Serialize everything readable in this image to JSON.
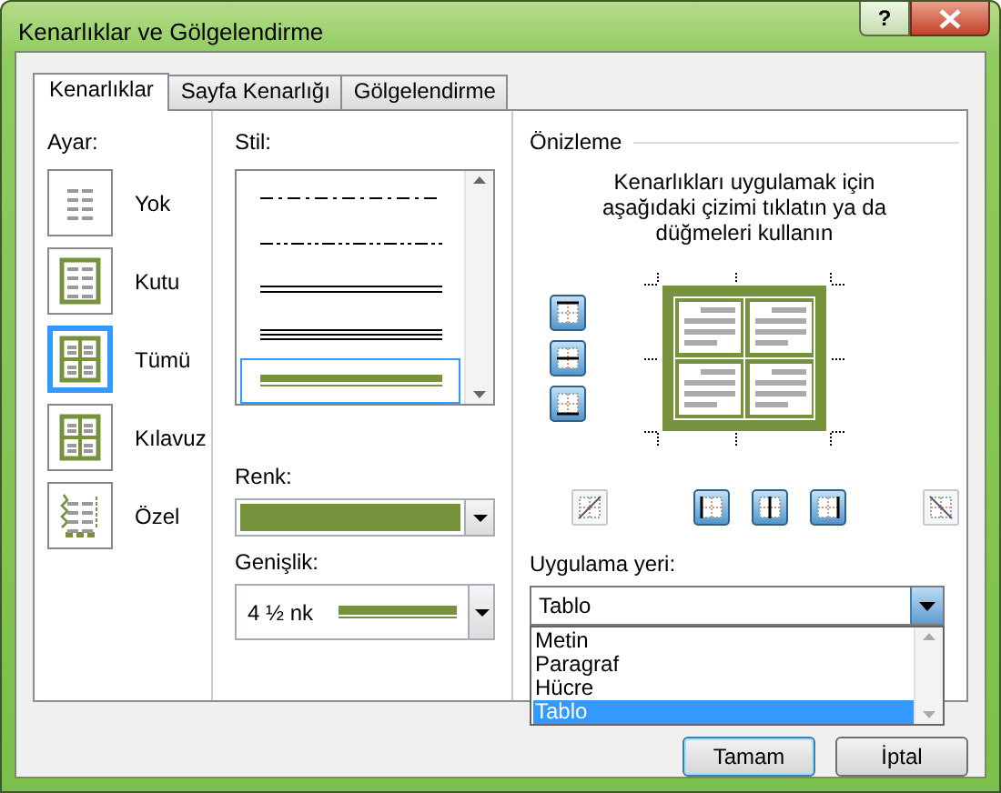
{
  "window": {
    "title": "Kenarlıklar ve Gölgelendirme",
    "help_button": "?"
  },
  "tabs": [
    {
      "label": "Kenarlıklar",
      "selected": true
    },
    {
      "label": "Sayfa Kenarlığı",
      "selected": false
    },
    {
      "label": "Gölgelendirme",
      "selected": false
    }
  ],
  "setting": {
    "label": "Ayar:",
    "items": [
      {
        "kind": "none",
        "label": "Yok",
        "selected": false
      },
      {
        "kind": "box",
        "label": "Kutu",
        "selected": false
      },
      {
        "kind": "all",
        "label": "Tümü",
        "selected": true
      },
      {
        "kind": "grid",
        "label": "Kılavuz",
        "selected": false
      },
      {
        "kind": "custom",
        "label": "Özel",
        "selected": false
      }
    ]
  },
  "style": {
    "label": "Stil:",
    "items": [
      {
        "kind": "dash-dot",
        "selected": false
      },
      {
        "kind": "dash-dot-dot",
        "selected": false
      },
      {
        "kind": "double",
        "selected": false
      },
      {
        "kind": "triple",
        "selected": false
      },
      {
        "kind": "thick-thin",
        "selected": true
      }
    ]
  },
  "color": {
    "label": "Renk:",
    "color": "#76923c"
  },
  "width": {
    "label": "Genişlik:",
    "value": "4 ½ nk"
  },
  "preview": {
    "title": "Önizleme",
    "hint": "Kenarlıkları uygulamak için aşağıdaki çizimi tıklatın ya da düğmeleri kullanın",
    "side_buttons": [
      {
        "kind": "top",
        "on": true
      },
      {
        "kind": "inside-horizontal",
        "on": true
      },
      {
        "kind": "bottom",
        "on": true
      }
    ],
    "bottom_buttons": [
      {
        "kind": "diagonal-up",
        "on": false
      },
      {
        "kind": "left",
        "on": true
      },
      {
        "kind": "inside-vertical",
        "on": true
      },
      {
        "kind": "right",
        "on": true
      },
      {
        "kind": "diagonal-down",
        "on": false
      }
    ]
  },
  "apply_to": {
    "label": "Uygulama yeri:",
    "value": "Tablo",
    "expanded": true,
    "options": [
      {
        "label": "Metin",
        "selected": false
      },
      {
        "label": "Paragraf",
        "selected": false
      },
      {
        "label": "Hücre",
        "selected": false
      },
      {
        "label": "Tablo",
        "selected": true
      }
    ]
  },
  "buttons": [
    "Tamam",
    "İptal"
  ]
}
